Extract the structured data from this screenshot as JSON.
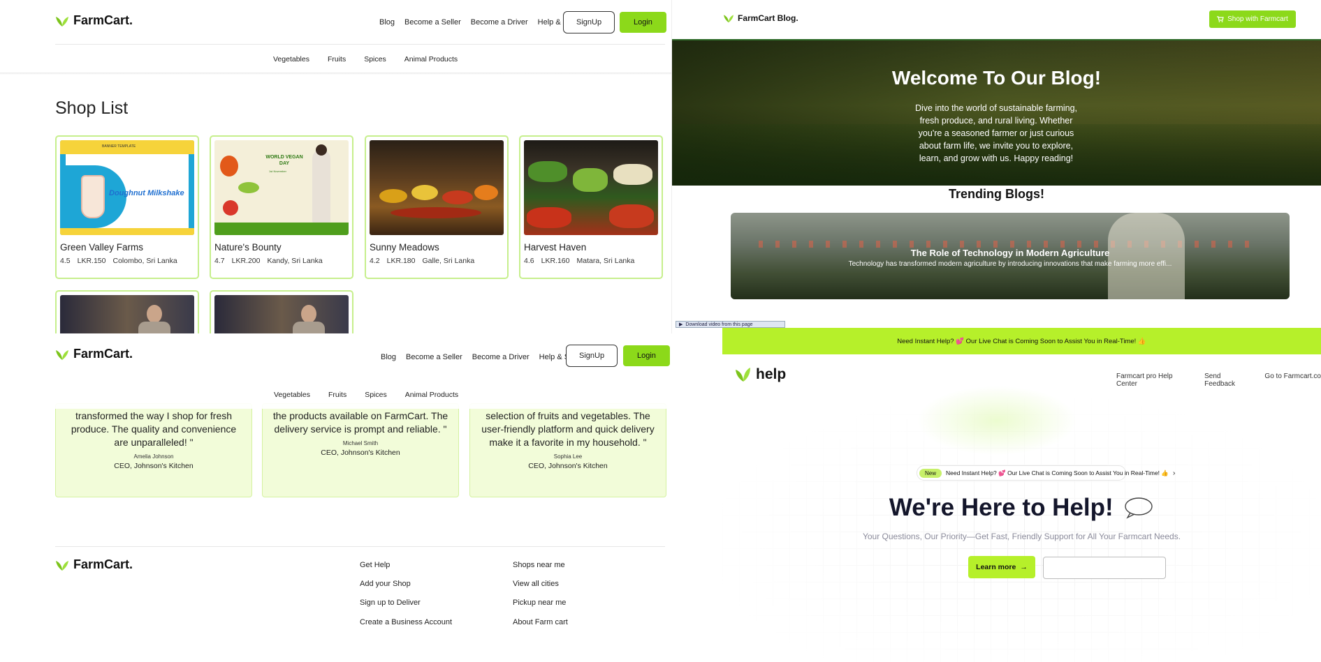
{
  "shop_panel": {
    "logo": "FarmCart.",
    "nav": [
      "Blog",
      "Become a Seller",
      "Become a Driver",
      "Help & Support"
    ],
    "signup_label": "SignUp",
    "login_label": "Login",
    "categories": [
      "Vegetables",
      "Fruits",
      "Spices",
      "Animal Products"
    ],
    "heading": "Shop List",
    "shops": [
      {
        "name": "Green Valley Farms",
        "rating": "4.5",
        "price": "LKR.150",
        "location": "Colombo, Sri Lanka",
        "banner_title": "Doughnut Milkshake",
        "banner_top": "BANNER TEMPLATE"
      },
      {
        "name": "Nature's Bounty",
        "rating": "4.7",
        "price": "LKR.200",
        "location": "Kandy, Sri Lanka",
        "banner_title": "WORLD VEGAN DAY",
        "banner_top": "1st November"
      },
      {
        "name": "Sunny Meadows",
        "rating": "4.2",
        "price": "LKR.180",
        "location": "Galle, Sri Lanka"
      },
      {
        "name": "Harvest Haven",
        "rating": "4.6",
        "price": "LKR.160",
        "location": "Matara, Sri Lanka"
      }
    ]
  },
  "nav2": {
    "logo": "FarmCart.",
    "nav": [
      "Blog",
      "Become a Seller",
      "Become a Driver",
      "Help & Support"
    ],
    "signup_label": "SignUp",
    "login_label": "Login",
    "categories": [
      "Vegetables",
      "Fruits",
      "Spices",
      "Animal Products"
    ]
  },
  "testimonials": [
    {
      "quote": "transformed the way I shop for fresh produce. The quality and convenience are unparalleled! \"",
      "name": "Amelia Johnson",
      "role": "CEO, Johnson's Kitchen"
    },
    {
      "quote": "the products available on FarmCart. The delivery service is prompt and reliable. \"",
      "name": "Michael Smith",
      "role": "CEO, Johnson's Kitchen"
    },
    {
      "quote": "selection of fruits and vegetables. The user-friendly platform and quick delivery make it a favorite in my household. \"",
      "name": "Sophia Lee",
      "role": "CEO, Johnson's Kitchen"
    }
  ],
  "footer": {
    "logo": "FarmCart.",
    "col1": [
      "Get Help",
      "Add your Shop",
      "Sign up to Deliver",
      "Create a Business Account"
    ],
    "col2": [
      "Shops near me",
      "View all cities",
      "Pickup near me",
      "About Farm cart"
    ]
  },
  "blog": {
    "logo": "FarmCart Blog.",
    "shop_button": "Shop with Farmcart",
    "hero_title": "Welcome To Our Blog!",
    "hero_text": "Dive into the world of sustainable farming, fresh produce, and rural living. Whether you're a seasoned farmer or just curious about farm life, we invite you to explore, learn, and grow with us. Happy reading!",
    "trending_heading": "Trending Blogs!",
    "trend_title": "The Role of Technology in Modern Agriculture",
    "trend_text": "Technology has transformed modern agriculture by introducing innovations that make farming more effi..."
  },
  "download_bar": "Download video from this page",
  "help": {
    "banner": "Need Instant Help? 💕 Our Live Chat is Coming Soon to Assist You in Real-Time! 👍",
    "logo": "help",
    "nav": [
      "Farmcart pro Help Center",
      "Send Feedback",
      "Go to Farmcart.co"
    ],
    "pill_badge": "New",
    "pill_text": "Need Instant Help? 💕 Our Live Chat is Coming Soon to Assist You in Real-Time! 👍",
    "title": "We're Here to Help!",
    "subtitle": "Your Questions, Our Priority—Get Fast, Friendly Support for All Your Farmcart Needs.",
    "learn_more": "Learn more"
  },
  "colors": {
    "accent": "#8cd91a",
    "banner": "#b6f02a",
    "dark_green": "#2f6b2a"
  }
}
